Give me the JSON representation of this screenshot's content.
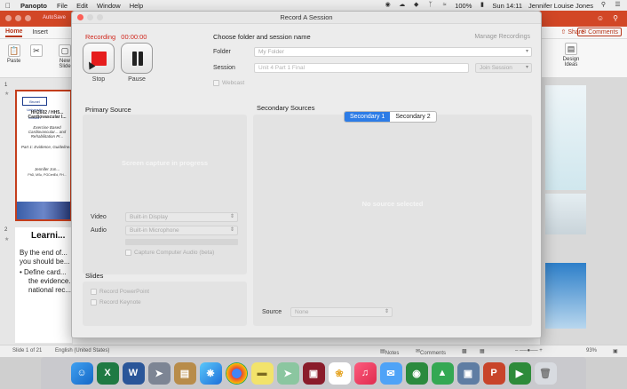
{
  "menubar": {
    "app": "Panopto",
    "items": [
      "File",
      "Edit",
      "Window",
      "Help"
    ],
    "battery": "100%",
    "clock": "Sun 14:11",
    "user": "Jennifer Louise Jones"
  },
  "ppt": {
    "autosave": "AutoSave",
    "tabs": [
      "Home",
      "Insert"
    ],
    "share": "Share",
    "comments": "Comments",
    "ribbon": {
      "paste": "Paste",
      "new_slide": "New Slide",
      "design_ideas": "Design Ideas"
    },
    "slides": [
      {
        "num": "1",
        "logo": "Brunel University London",
        "title": "HH2602 / HH5... Cardiovascular I...",
        "subtitle": "Exercise Based Cardiovascular... and Rehabilitation Pr...",
        "part": "Part 1: Evidence, Guideline...",
        "author": "Jennifer Jon...",
        "degrees": "PhD, MSc, PGCertEd, FH..."
      },
      {
        "num": "2",
        "heading": "Learni...",
        "lines": [
          "By the end of...",
          "you should be...",
          "•  Define card...",
          "the evidence...",
          "national rec..."
        ]
      }
    ],
    "status": {
      "slide": "Slide 1 of 21",
      "language": "English (United States)",
      "notes": "Notes",
      "comments": "Comments",
      "zoom": "93%"
    }
  },
  "dialog": {
    "title": "Record A Session",
    "recording_label": "Recording",
    "recording_time": "00:00:00",
    "stop_label": "Stop",
    "pause_label": "Pause",
    "choose_heading": "Choose folder and session name",
    "manage_recordings": "Manage Recordings",
    "folder_label": "Folder",
    "folder_value": "My Folder",
    "session_label": "Session",
    "session_value": "Unit 4 Part 1 Final",
    "join_session": "Join Session",
    "webcast": "Webcast",
    "primary_heading": "Primary Source",
    "primary_status": "Screen capture in progress",
    "video_label": "Video",
    "video_value": "Built-in Display",
    "audio_label": "Audio",
    "audio_value": "Built-in Microphone",
    "capture_audio": "Capture Computer Audio (beta)",
    "slides_heading": "Slides",
    "record_powerpoint": "Record PowerPoint",
    "record_keynote": "Record Keynote",
    "secondary_heading": "Secondary Sources",
    "secondary_tabs": [
      "Secondary 1",
      "Secondary 2"
    ],
    "secondary_status": "No source selected",
    "source_label": "Source",
    "source_value": "None"
  },
  "dock": {
    "apps": [
      "finder-icon",
      "excel-icon",
      "word-icon",
      "launchpad-icon",
      "notes-icon",
      "safari-icon",
      "chrome-icon",
      "stickies-icon",
      "maps-icon",
      "photobooth-icon",
      "photos-icon",
      "music-icon",
      "messages-icon",
      "network-icon",
      "app-icon",
      "preview-icon",
      "powerpoint-icon",
      "panopto-icon",
      "trash-icon"
    ]
  }
}
